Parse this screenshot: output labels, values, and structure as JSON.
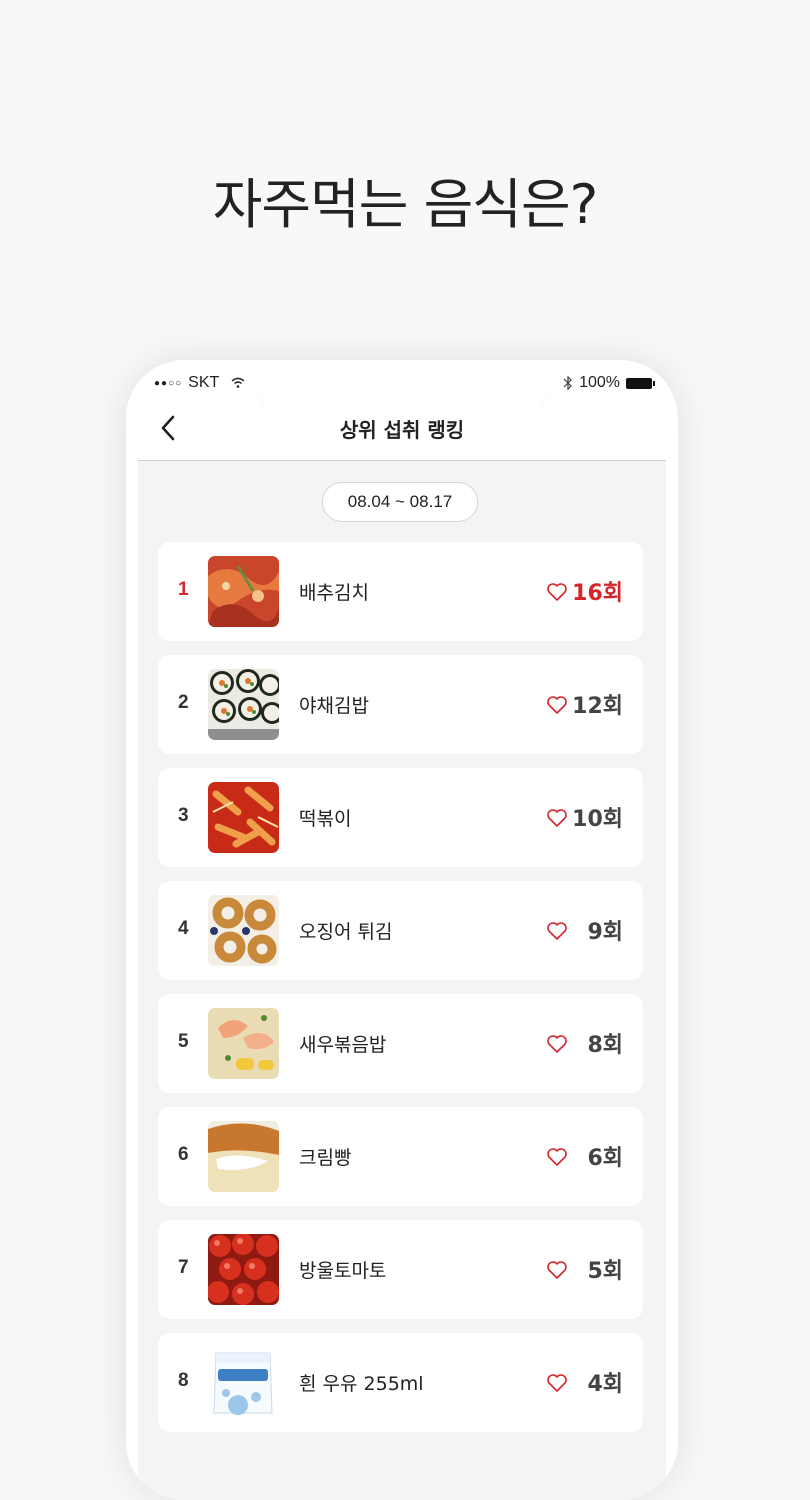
{
  "headline": "자주먹는 음식은?",
  "status": {
    "carrier": "SKT",
    "battery": "100%"
  },
  "nav": {
    "title": "상위 섭취 랭킹"
  },
  "period": "08.04 ~ 08.17",
  "colors": {
    "accent": "#d6252c",
    "text": "#222222"
  },
  "foods": [
    {
      "rank": "1",
      "name": "배추김치",
      "count": "16회",
      "image": "kimchi"
    },
    {
      "rank": "2",
      "name": "야채김밥",
      "count": "12회",
      "image": "gimbap"
    },
    {
      "rank": "3",
      "name": "떡볶이",
      "count": "10회",
      "image": "tteokbokki"
    },
    {
      "rank": "4",
      "name": "오징어 튀김",
      "count": "9회",
      "image": "fried-squid"
    },
    {
      "rank": "5",
      "name": "새우볶음밥",
      "count": "8회",
      "image": "shrimp-fried-rice"
    },
    {
      "rank": "6",
      "name": "크림빵",
      "count": "6회",
      "image": "cream-bread"
    },
    {
      "rank": "7",
      "name": "방울토마토",
      "count": "5회",
      "image": "cherry-tomato"
    },
    {
      "rank": "8",
      "name": "흰 우유 255ml",
      "count": "4회",
      "image": "milk-carton"
    }
  ]
}
